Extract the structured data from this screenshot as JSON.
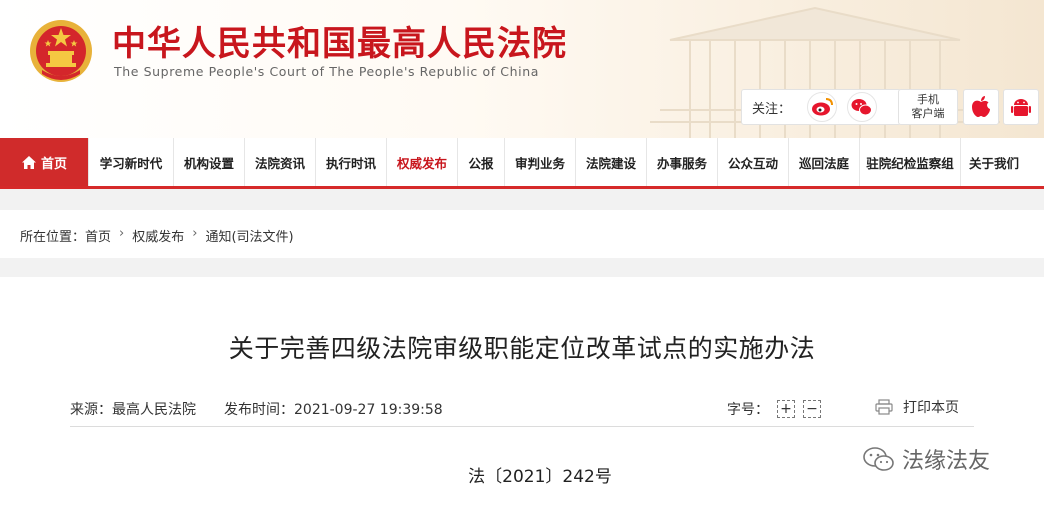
{
  "header": {
    "title_cn": "中华人民共和国最高人民法院",
    "title_en": "The Supreme People's Court of The People's Republic of China",
    "follow_label": "关注：",
    "mobile_line1": "手机",
    "mobile_line2": "客户端",
    "icons": [
      "national-emblem",
      "weibo-icon",
      "wechat-icon",
      "apple-icon",
      "android-icon"
    ]
  },
  "nav": {
    "home_label": "首页",
    "items": [
      {
        "label": "学习新时代"
      },
      {
        "label": "机构设置"
      },
      {
        "label": "法院资讯"
      },
      {
        "label": "执行时讯"
      },
      {
        "label": "权威发布"
      },
      {
        "label": "公报"
      },
      {
        "label": "审判业务"
      },
      {
        "label": "法院建设"
      },
      {
        "label": "办事服务"
      },
      {
        "label": "公众互动"
      },
      {
        "label": "巡回法庭"
      },
      {
        "label": "驻院纪检监察组"
      },
      {
        "label": "关于我们"
      }
    ],
    "active_item": "权威发布"
  },
  "breadcrumb": {
    "prefix": "所在位置：",
    "items": [
      "首页",
      "权威发布",
      "通知(司法文件)"
    ]
  },
  "article": {
    "title": "关于完善四级法院审级职能定位改革试点的实施办法",
    "source_label": "来源：",
    "source": "最高人民法院",
    "time_label": "发布时间：",
    "time": "2021-09-27 19:39:58",
    "font_size_label": "字号：",
    "font_plus": "+",
    "font_minus": "−",
    "print_label": "打印本页",
    "doc_number": "法〔2021〕242号"
  },
  "watermark": {
    "text": "法缘法友"
  },
  "colors": {
    "brand_red": "#c8161d",
    "nav_home_bg": "#d02b2b",
    "page_bg": "#f2f2f2"
  }
}
